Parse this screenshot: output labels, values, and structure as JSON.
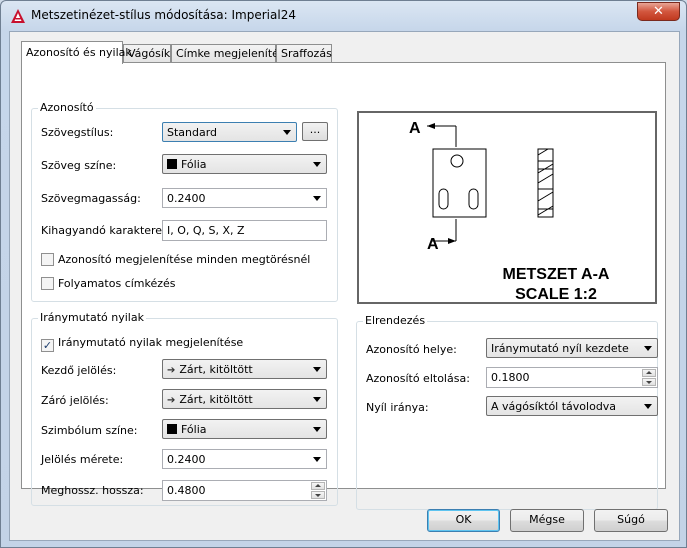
{
  "window": {
    "title": "Metszetinézet-stílus módosítása: Imperial24",
    "close_label": "✕"
  },
  "tabs": [
    {
      "label": "Azonosító és nyilak"
    },
    {
      "label": "Vágósík"
    },
    {
      "label": "Címke megjelenítése"
    },
    {
      "label": "Sraffozás"
    }
  ],
  "identifier": {
    "group_title": "Azonosító",
    "text_style_label": "Szövegstílus:",
    "text_style_value": "Standard",
    "browse_label": "...",
    "text_color_label": "Szöveg színe:",
    "text_color_value": "Fólia",
    "text_height_label": "Szövegmagasság:",
    "text_height_value": "0.2400",
    "exclude_chars_label": "Kihagyandó karakterek:",
    "exclude_chars_value": "I, O, Q, S, X, Z",
    "show_all_bends_label": "Azonosító megjelenítése minden megtörésnél",
    "show_all_bends_checked": false,
    "continuous_label": "Folyamatos címkézés",
    "continuous_checked": false
  },
  "arrows": {
    "group_title": "Iránymutató nyilak",
    "show_arrows_label": "Iránymutató nyilak megjelenítése",
    "show_arrows_checked": true,
    "start_symbol_label": "Kezdő jelölés:",
    "start_symbol_value": "Zárt, kitöltött",
    "end_symbol_label": "Záró jelölés:",
    "end_symbol_value": "Zárt, kitöltött",
    "symbol_color_label": "Szimbólum színe:",
    "symbol_color_value": "Fólia",
    "symbol_size_label": "Jelölés mérete:",
    "symbol_size_value": "0.2400",
    "extension_label": "Meghossz. hossza:",
    "extension_value": "0.4800"
  },
  "preview": {
    "label_a_top": "A",
    "label_a_bottom": "A",
    "caption_line1": "METSZET A-A",
    "caption_line2": "SCALE 1:2"
  },
  "layout_group": {
    "group_title": "Elrendezés",
    "position_label": "Azonosító helye:",
    "position_value": "Iránymutató nyíl kezdete",
    "offset_label": "Azonosító eltolása:",
    "offset_value": "0.1800",
    "direction_label": "Nyíl iránya:",
    "direction_value": "A vágósíktól távolodva"
  },
  "buttons": {
    "ok": "OK",
    "cancel": "Mégse",
    "help": "Súgó"
  },
  "colors": {
    "accent": "#3c7fb1",
    "close": "#c0391f",
    "icon": "#c8102e"
  }
}
